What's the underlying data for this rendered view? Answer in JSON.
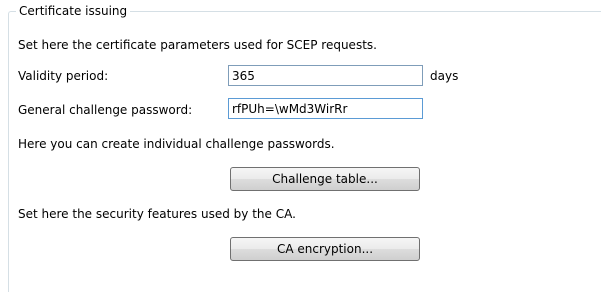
{
  "group": {
    "title": "Certificate issuing"
  },
  "intro_text": "Set here the certificate parameters used for SCEP requests.",
  "validity": {
    "label": "Validity period:",
    "value": "365",
    "unit": "days"
  },
  "challenge": {
    "label": "General challenge password:",
    "value": "rfPUh=\\wMd3WirRr"
  },
  "individual_text": "Here you can create individual challenge passwords.",
  "challenge_table_button": "Challenge table...",
  "security_text": "Set here the security features used by the CA.",
  "ca_encryption_button": "CA encryption..."
}
